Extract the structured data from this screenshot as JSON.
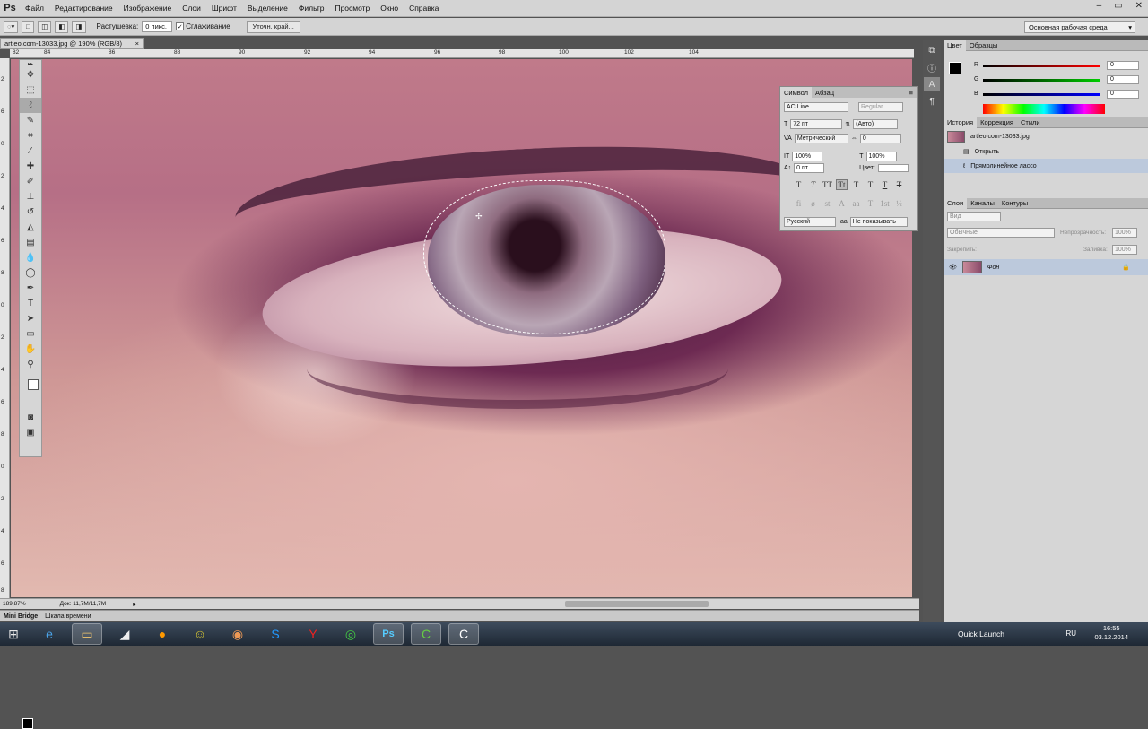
{
  "app": {
    "logo": "Ps"
  },
  "menu": [
    "Файл",
    "Редактирование",
    "Изображение",
    "Слои",
    "Шрифт",
    "Выделение",
    "Фильтр",
    "Просмотр",
    "Окно",
    "Справка"
  ],
  "options": {
    "feather_label": "Растушевка:",
    "feather_value": "0 пикс.",
    "antialias_label": "Сглаживание",
    "antialias_checked": true,
    "refine_edge": "Уточн. край...",
    "workspace": "Основная рабочая среда"
  },
  "document": {
    "tab_title": "artleo.com-13033.jpg @ 190% (RGB/8)",
    "close": "×"
  },
  "ruler_h": [
    "82",
    "84",
    "86",
    "88",
    "90",
    "92",
    "94",
    "96",
    "98",
    "100",
    "102",
    "104"
  ],
  "ruler_v": [
    "2",
    "6",
    "0",
    "2",
    "4",
    "6",
    "8",
    "0",
    "2",
    "4",
    "6",
    "8",
    "0",
    "2",
    "4",
    "6",
    "8"
  ],
  "character_panel": {
    "tabs": [
      "Символ",
      "Абзац"
    ],
    "font": "AC Line",
    "style": "Regular",
    "size": "72 пт",
    "leading": "(Авто)",
    "kerning": "Метрический",
    "tracking": "0",
    "vscale": "100%",
    "hscale": "100%",
    "baseline": "0 пт",
    "color_label": "Цвет:",
    "glyphs": [
      "T",
      "T",
      "TT",
      "Tt",
      "T",
      "T",
      "T",
      "T"
    ],
    "glyphs2": [
      "fi",
      "ø",
      "st",
      "A",
      "aa",
      "T",
      "1st",
      "½"
    ],
    "language": "Русский",
    "aa_label": "aa",
    "antialias": "Не показывать"
  },
  "color_panel": {
    "tabs": [
      "Цвет",
      "Образцы"
    ],
    "channels": [
      {
        "name": "R",
        "value": "0"
      },
      {
        "name": "G",
        "value": "0"
      },
      {
        "name": "B",
        "value": "0"
      }
    ]
  },
  "history_panel": {
    "tabs": [
      "История",
      "Коррекция",
      "Стили"
    ],
    "snapshot": "artleo.com-13033.jpg",
    "items": [
      "Открыть",
      "Прямолинейное лассо"
    ]
  },
  "layers_panel": {
    "tabs": [
      "Слои",
      "Каналы",
      "Контуры"
    ],
    "kind": "Вид",
    "blend": "Обычные",
    "opacity_label": "Непрозрачность:",
    "opacity": "100%",
    "lock_label": "Закрепить:",
    "fill_label": "Заливка:",
    "fill": "100%",
    "layer_name": "Фон"
  },
  "status": {
    "zoom": "189,87%",
    "doc": "Док: 11,7M/11,7M"
  },
  "minibridge": [
    "Mini Bridge",
    "Шкала времени"
  ],
  "taskbar": {
    "quick_launch": "Quick Launch",
    "lang": "RU",
    "time": "16:55",
    "date": "03.12.2014",
    "ps_label": "Ps"
  }
}
